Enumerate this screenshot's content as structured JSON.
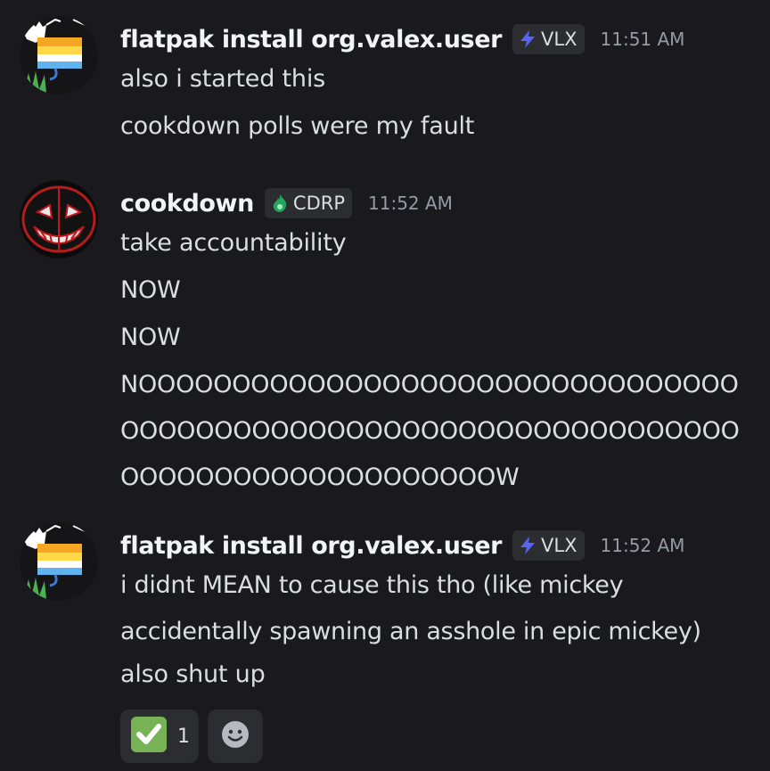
{
  "messages": [
    {
      "username": "flatpak install org.valex.user",
      "tag": "VLX",
      "tag_icon": "lightning-bolt-icon",
      "timestamp": "11:51 AM",
      "avatar": "flatpak-avatar",
      "lines": [
        "also i started this",
        "cookdown polls were my fault"
      ]
    },
    {
      "username": "cookdown",
      "tag": "CDRP",
      "tag_icon": "green-flame-icon",
      "timestamp": "11:52 AM",
      "avatar": "cookdown-avatar",
      "lines": [
        "take accountability",
        "NOW",
        "NOW",
        "NOOOOOOOOOOOOOOOOOOOOOOOOOOOOOOOOOOOOOOOOOOOOOOOOOOOOOOOOOOOOOOOOOOOOOOOOOOOOOOOOOOOOOW"
      ]
    },
    {
      "username": "flatpak install org.valex.user",
      "tag": "VLX",
      "tag_icon": "lightning-bolt-icon",
      "timestamp": "11:52 AM",
      "avatar": "flatpak-avatar",
      "lines": [
        "i didnt MEAN to cause this tho (like mickey accidentally spawning an asshole in epic mickey)",
        "also shut up"
      ],
      "reactions": [
        {
          "emoji": "white-check-mark-icon",
          "count": "1"
        },
        {
          "emoji": "add-reaction-smiley-icon"
        }
      ]
    }
  ],
  "colors": {
    "background": "#1a1a1e",
    "username": "#f2f3f5",
    "text": "#dbdee1",
    "timestamp": "#949ba4",
    "tag_bg": "#2b2d31",
    "lightning": "#5865f2",
    "flame": "#23a55a",
    "check": "#77b255"
  }
}
